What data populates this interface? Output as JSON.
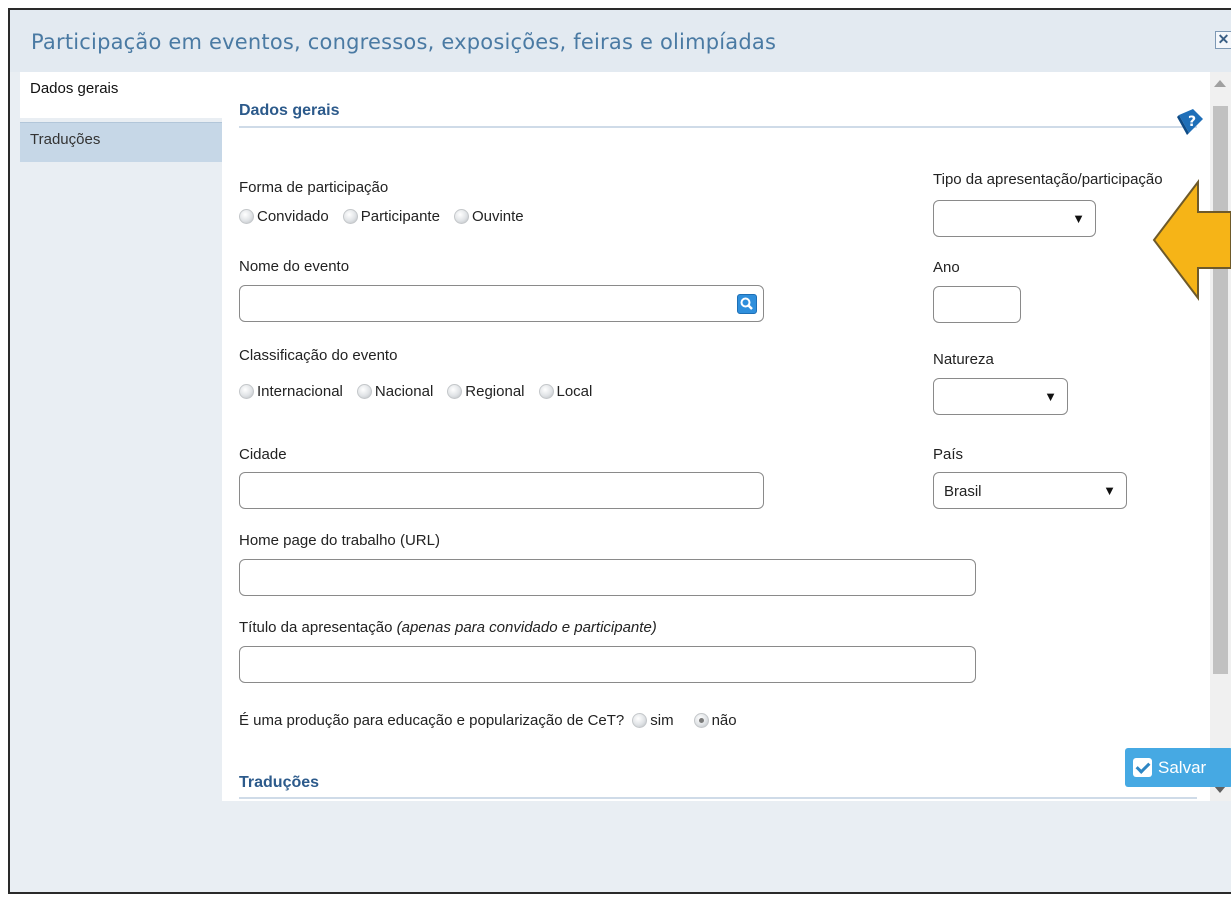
{
  "dialog": {
    "title": "Participação em eventos, congressos, exposições, feiras e olimpíadas",
    "close_icon": "close-icon"
  },
  "tabs": [
    {
      "label": "Dados gerais",
      "active": true
    },
    {
      "label": "Traduções",
      "active": false
    }
  ],
  "sections": {
    "dados_gerais": "Dados gerais",
    "traducoes": "Traduções"
  },
  "form": {
    "forma_participacao": {
      "label": "Forma de participação",
      "options": [
        "Convidado",
        "Participante",
        "Ouvinte"
      ]
    },
    "tipo_apresentacao": {
      "label": "Tipo da apresentação/participação",
      "value": ""
    },
    "nome_evento": {
      "label": "Nome do evento",
      "value": ""
    },
    "ano": {
      "label": "Ano",
      "value": ""
    },
    "classificacao": {
      "label": "Classificação do evento",
      "options": [
        "Internacional",
        "Nacional",
        "Regional",
        "Local"
      ]
    },
    "natureza": {
      "label": "Natureza",
      "value": ""
    },
    "cidade": {
      "label": "Cidade",
      "value": ""
    },
    "pais": {
      "label": "País",
      "value": "Brasil"
    },
    "home_page": {
      "label": "Home page do trabalho (URL)",
      "value": ""
    },
    "titulo": {
      "label": "Título da apresentação",
      "hint": "(apenas para convidado e participante)",
      "value": ""
    },
    "educacao": {
      "label": "É uma produção para educação e popularização de CeT?",
      "options": [
        "sim",
        "não"
      ],
      "selected": "não"
    }
  },
  "footer": {
    "save_label": "Salvar"
  },
  "colors": {
    "title": "#4a7aa3",
    "section_head": "#2c5a8b",
    "save_button": "#46a9e3",
    "arrow": "#f6b417"
  }
}
